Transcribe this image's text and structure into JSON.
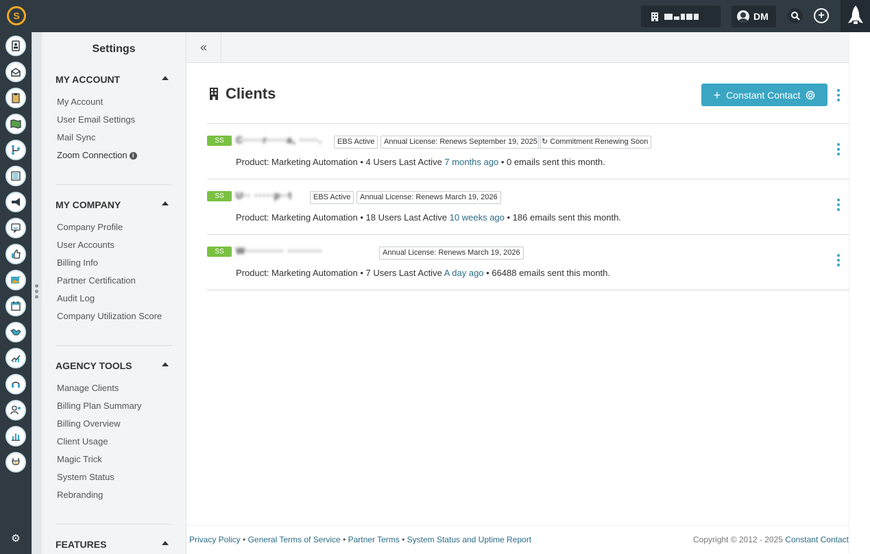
{
  "topbar": {
    "logo": "logo-icon",
    "user_initials": "DM",
    "search_icon": "search-icon",
    "add_icon": "plus-icon",
    "rocket_icon": "rocket-icon"
  },
  "rail": {
    "icons": [
      "contacts-icon",
      "email-icon",
      "clipboard-icon",
      "map-icon",
      "workflow-icon",
      "list-icon",
      "megaphone-icon",
      "chat-icon",
      "thumbs-up-icon",
      "image-icon",
      "calendar-icon",
      "handshake-icon",
      "analytics-icon",
      "headset-icon",
      "user-star-icon",
      "bar-chart-icon",
      "plug-icon"
    ],
    "settings_icon": "gear-icon"
  },
  "settings": {
    "title": "Settings",
    "my_account": {
      "heading": "MY ACCOUNT",
      "items": [
        "My Account",
        "User Email Settings",
        "Mail Sync",
        "Zoom Connection"
      ]
    },
    "my_company": {
      "heading": "MY COMPANY",
      "items": [
        "Company Profile",
        "User Accounts",
        "Billing Info",
        "Partner Certification",
        "Audit Log",
        "Company Utilization Score"
      ]
    },
    "agency_tools": {
      "heading": "AGENCY TOOLS",
      "items": [
        "Manage Clients",
        "Billing Plan Summary",
        "Billing Overview",
        "Client Usage",
        "Magic Trick",
        "System Status",
        "Rebranding"
      ]
    },
    "features": {
      "heading": "FEATURES"
    }
  },
  "main": {
    "collapse_label": "«",
    "title": "Clients",
    "cc_button": "Constant Contact",
    "clients": [
      {
        "badge": "SS",
        "name": "C·····r·····a, ·····.",
        "tags": [
          "EBS Active",
          "Annual License: Renews September 19, 2025",
          "Commitment Renewing Soon"
        ],
        "detail_prefix": "Product: Marketing Automation • 4 Users Last Active ",
        "last_active": "7 months ago",
        "detail_suffix": " • 0 emails sent this month."
      },
      {
        "badge": "SS",
        "name": "U·· ·····p··t",
        "tags": [
          "EBS Active",
          "Annual License: Renews March 19, 2026"
        ],
        "detail_prefix": "Product: Marketing Automation • 18 Users Last Active ",
        "last_active": "10 weeks ago",
        "detail_suffix": " • 186 emails sent this month."
      },
      {
        "badge": "SS",
        "name": "W·········· ·········",
        "tags": [
          "Annual License: Renews March 19, 2026"
        ],
        "detail_prefix": "Product: Marketing Automation • 7 Users Last Active ",
        "last_active": "A day ago",
        "detail_suffix": " • 66488 emails sent this month."
      }
    ]
  },
  "footer": {
    "links": [
      "Privacy Policy",
      "General Terms of Service",
      "Partner Terms",
      "System Status and Uptime Report"
    ],
    "copyright": "Copyright © 2012 - 2025 ",
    "copyright_link": "Constant Contact"
  }
}
